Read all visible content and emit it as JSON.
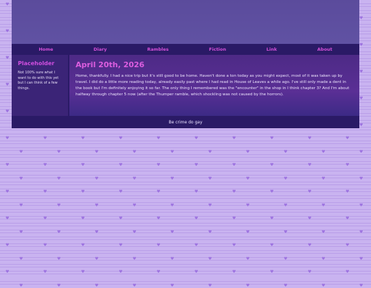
{
  "nav": {
    "items": [
      {
        "label": "Home"
      },
      {
        "label": "Diary"
      },
      {
        "label": "Rambles"
      },
      {
        "label": "Fiction"
      },
      {
        "label": "Link"
      },
      {
        "label": "About"
      }
    ]
  },
  "sidebar": {
    "title": "Placeholder",
    "text": "Not 100% sure what I want to do with this yet but I can think of a few things."
  },
  "post": {
    "title": "April 20th, 2026",
    "body": "Home, thankfully. I had a nice trip but it's still good to be home. Haven't done a ton today as you might expect, most of it was taken up by travel. I did do a little more reading today, already easily past where I had read in House of Leaves a while ago. I've still only made a dent in the book but I'm definitely enjoying it so far. The only thing I remembered was the \"encounter\" in the shop in I think chapter 3? And I'm about halfway through chapter 5 now (after the Thumper ramble, which shockling was not caused by the horrors)."
  },
  "footer": {
    "text": "Be crime do gay"
  },
  "colors": {
    "background": "#c9b3f0",
    "banner": "#5b4b9c",
    "nav": "#2a1a66",
    "accent": "#d44fd8"
  }
}
